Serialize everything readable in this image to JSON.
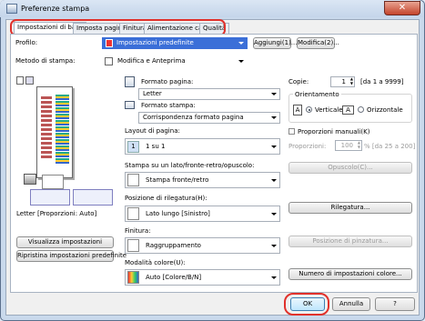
{
  "window": {
    "title": "Preferenze stampa",
    "close_glyph": "✕"
  },
  "tabs": [
    "Impostazioni di base",
    "Imposta pagina",
    "Finitura",
    "Alimentazione carta",
    "Qualità"
  ],
  "profile": {
    "label": "Profilo:",
    "value": "Impostazioni predefinite",
    "add_button": "Aggiungi(1)...",
    "edit_button": "Modifica(2)..."
  },
  "output_method": {
    "label": "Metodo di stampa:",
    "value": "Modifica e Anteprima"
  },
  "preview": {
    "caption": "Letter [Proporzioni: Auto]"
  },
  "left_buttons": {
    "view_settings": "Visualizza impostazioni",
    "restore_defaults": "Ripristina impostazioni predefinite"
  },
  "page_size": {
    "label": "Formato pagina:",
    "value": "Letter"
  },
  "output_size": {
    "label": "Formato stampa:",
    "value": "Corrispondenza formato pagina"
  },
  "copies": {
    "label": "Copie:",
    "value": "1",
    "range": "[da 1 a 9999]"
  },
  "orientation": {
    "label": "Orientamento",
    "vertical": "Verticale",
    "horizontal": "Orizzontale",
    "vertical_icon": "A",
    "horizontal_icon": "A"
  },
  "page_layout": {
    "label": "Layout di pagina:",
    "value": "1 su 1",
    "icon_text": "1"
  },
  "manual_scaling": {
    "label": "Proporzioni manuali(K)",
    "field_label": "Proporzioni:",
    "value": "100",
    "range": "% [da 25 a 200]"
  },
  "print_style": {
    "label": "Stampa su un lato/fronte-retro/opuscolo:",
    "value": "Stampa fronte/retro",
    "booklet_button": "Opuscolo(C)..."
  },
  "binding": {
    "label": "Posizione di rilegatura(H):",
    "value": "Lato lungo [Sinistro]",
    "button": "Rilegatura..."
  },
  "finishing": {
    "label": "Finitura:",
    "value": "Raggruppamento",
    "staple_button": "Posizione di pinzatura..."
  },
  "color_mode": {
    "label": "Modalità colore(U):",
    "value": "Auto [Colore/B/N]",
    "button": "Numero di impostazioni colore..."
  },
  "footer": {
    "ok": "OK",
    "cancel": "Annulla",
    "help": "?"
  },
  "colors": {
    "highlight": "#e0312b",
    "selection": "#3b6fd8"
  }
}
